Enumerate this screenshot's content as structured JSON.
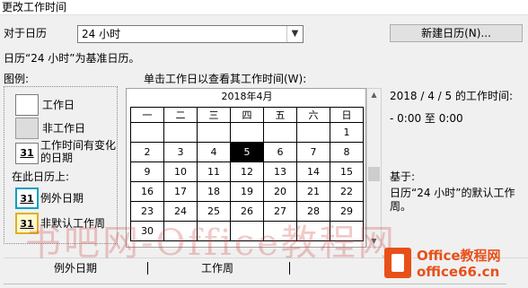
{
  "window": {
    "title": "更改工作时间"
  },
  "calendar_for": {
    "label": "对于日历",
    "value": "24 小时",
    "new_button": "新建日历(N)..."
  },
  "base_note": "日历“24 小时”为基准日历。",
  "legend": {
    "title": "图例:",
    "items": [
      {
        "swatch": "",
        "label": "工作日"
      },
      {
        "swatch": "",
        "label": "非工作日"
      },
      {
        "swatch": "31",
        "label": "工作时间有变化的日期"
      }
    ],
    "on_this_calendar": "在此日历上:",
    "items2": [
      {
        "swatch": "31",
        "label": "例外日期"
      },
      {
        "swatch": "31",
        "label": "非默认工作周"
      }
    ]
  },
  "calendar": {
    "instruction": "单击工作日以查看其工作时间(W):",
    "month": "2018年4月",
    "weekdays": [
      "一",
      "二",
      "三",
      "四",
      "五",
      "六",
      "日"
    ],
    "weeks": [
      [
        "",
        "",
        "",
        "",
        "",
        "",
        "1"
      ],
      [
        "2",
        "3",
        "4",
        "5",
        "6",
        "7",
        "8"
      ],
      [
        "9",
        "10",
        "11",
        "12",
        "13",
        "14",
        "15"
      ],
      [
        "16",
        "17",
        "18",
        "19",
        "20",
        "21",
        "22"
      ],
      [
        "23",
        "24",
        "25",
        "26",
        "27",
        "28",
        "29"
      ],
      [
        "30",
        "",
        "",
        "",
        "",
        "",
        ""
      ]
    ],
    "selected_day": "5"
  },
  "info": {
    "heading": "2018 / 4 / 5 的工作时间:",
    "time": "- 0:00 至 0:00",
    "based_on": "基于:",
    "based_text": "日历“24 小时”的默认工作周。"
  },
  "tabs": [
    "例外日期",
    "工作周"
  ],
  "watermark": "书吧网-Office教程网",
  "brand": {
    "line1": "Office教程网",
    "line2": "office66.cn",
    "accent": "#e8501a"
  }
}
